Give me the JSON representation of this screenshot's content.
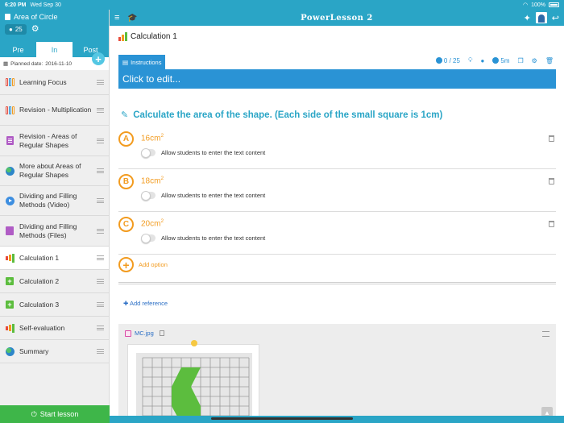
{
  "status_bar": {
    "time": "6:20 PM",
    "date": "Wed Sep 30",
    "battery": "100%"
  },
  "sidebar": {
    "title": "Area of Circle",
    "student_count": "25",
    "tabs": [
      {
        "label": "Pre",
        "active": false
      },
      {
        "label": "In",
        "active": true
      },
      {
        "label": "Post",
        "active": false
      }
    ],
    "planned_label": "Planned date:",
    "planned_date": "2016-11-10",
    "items": [
      {
        "label": "Learning Focus",
        "icon": "books-icon",
        "active": false
      },
      {
        "label": "Revision - Multiplication",
        "icon": "books-icon",
        "active": false
      },
      {
        "label": "Revision - Areas of Regular Shapes",
        "icon": "document-icon",
        "active": false
      },
      {
        "label": "More about Areas of Regular Shapes",
        "icon": "globe-icon",
        "active": false
      },
      {
        "label": "Dividing and Filling Methods (Video)",
        "icon": "play-icon",
        "active": false
      },
      {
        "label": "Dividing and Filling Methods (Files)",
        "icon": "folder-icon",
        "active": false
      },
      {
        "label": "Calculation 1",
        "icon": "bar-chart-icon",
        "active": true
      },
      {
        "label": "Calculation 2",
        "icon": "plus-box-icon",
        "active": false
      },
      {
        "label": "Calculation 3",
        "icon": "plus-box-icon",
        "active": false
      },
      {
        "label": "Self-evaluation",
        "icon": "bar-chart-icon",
        "active": false
      },
      {
        "label": "Summary",
        "icon": "globe-icon",
        "active": false
      }
    ],
    "start_button": "Start lesson"
  },
  "topbar": {
    "brand": "PowerLesson 2"
  },
  "main": {
    "lesson_title": "Calculation 1",
    "instructions_tab": "Instructions",
    "toolbar": {
      "answers": "0 / 25",
      "time": "5m"
    },
    "instructions_placeholder": "Click to edit...",
    "question": "Calculate the area of the shape. (Each side of the small square is 1cm)",
    "options": [
      {
        "letter": "A",
        "value": "16cm",
        "unit_sup": "2",
        "toggle_label": "Allow students to enter the text content"
      },
      {
        "letter": "B",
        "value": "18cm",
        "unit_sup": "2",
        "toggle_label": "Allow students to enter the text content"
      },
      {
        "letter": "C",
        "value": "20cm",
        "unit_sup": "2",
        "toggle_label": "Allow students to enter the text content"
      }
    ],
    "add_option": "Add option",
    "add_reference": "Add reference",
    "attachment_name": "MC.jpg"
  },
  "colors": {
    "accent": "#2aa5c6",
    "instruction_blue": "#2a93d5",
    "option_orange": "#f29b1f",
    "start_green": "#3eb649"
  }
}
